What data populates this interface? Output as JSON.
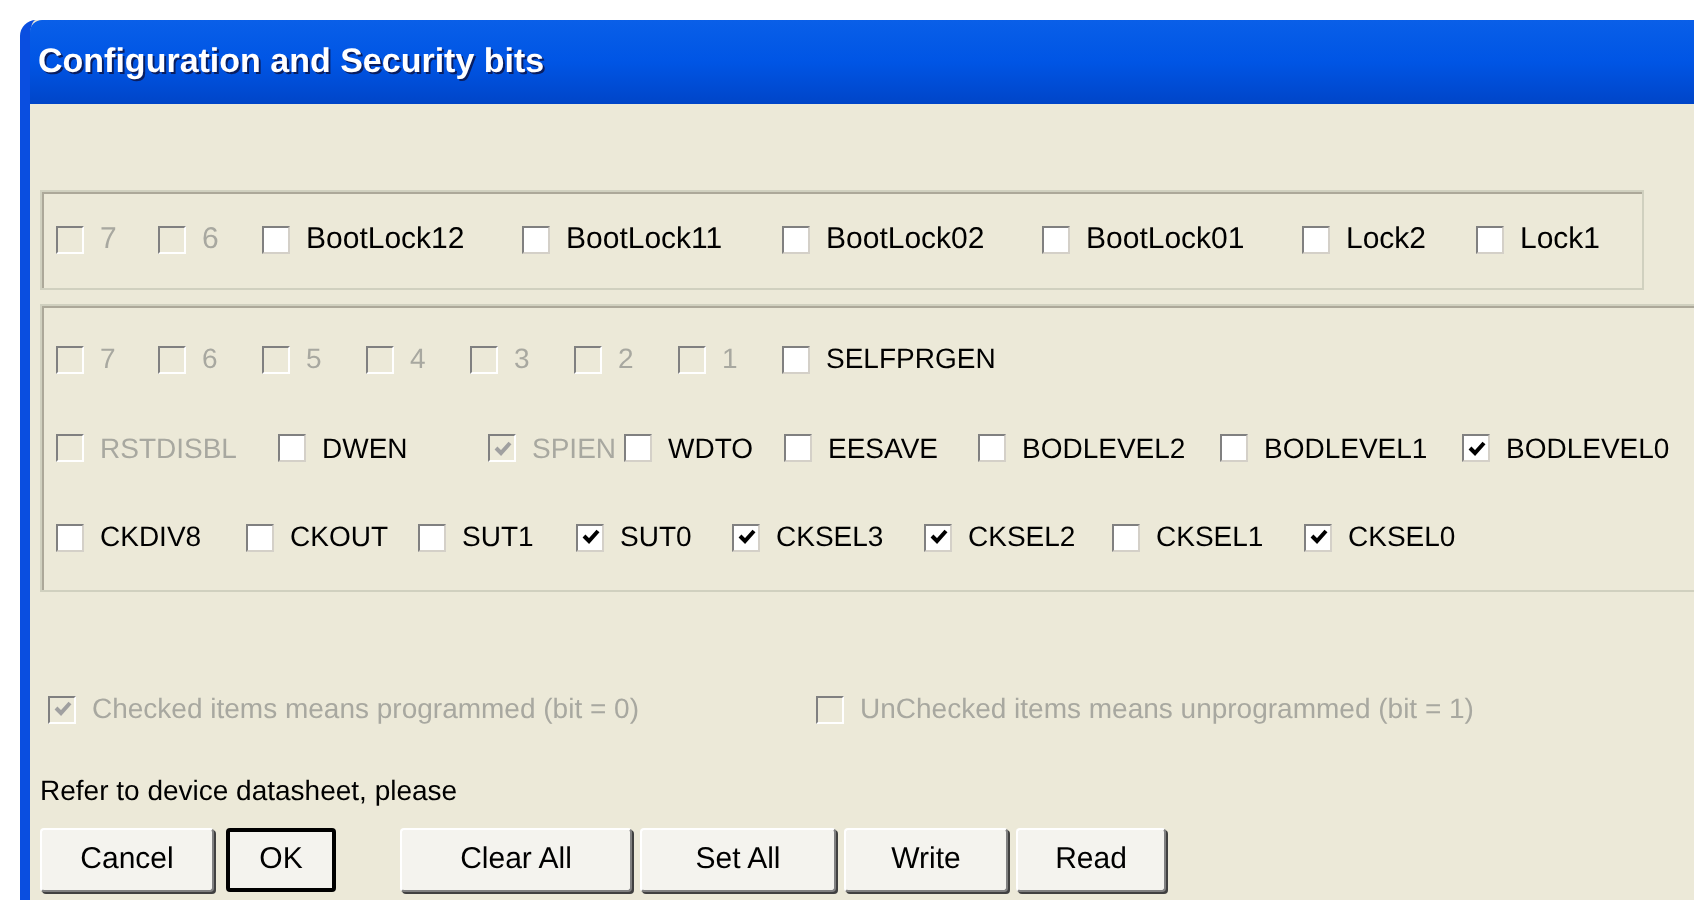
{
  "window": {
    "title": "Configuration and Security bits"
  },
  "lock_bits": [
    {
      "label": "7",
      "checked": false,
      "disabled": true
    },
    {
      "label": "6",
      "checked": false,
      "disabled": true
    },
    {
      "label": "BootLock12",
      "checked": false,
      "disabled": false
    },
    {
      "label": "BootLock11",
      "checked": false,
      "disabled": false
    },
    {
      "label": "BootLock02",
      "checked": false,
      "disabled": false
    },
    {
      "label": "BootLock01",
      "checked": false,
      "disabled": false
    },
    {
      "label": "Lock2",
      "checked": false,
      "disabled": false
    },
    {
      "label": "Lock1",
      "checked": false,
      "disabled": false
    }
  ],
  "fuse_rows": [
    [
      {
        "label": "7",
        "checked": false,
        "disabled": true
      },
      {
        "label": "6",
        "checked": false,
        "disabled": true
      },
      {
        "label": "5",
        "checked": false,
        "disabled": true
      },
      {
        "label": "4",
        "checked": false,
        "disabled": true
      },
      {
        "label": "3",
        "checked": false,
        "disabled": true
      },
      {
        "label": "2",
        "checked": false,
        "disabled": true
      },
      {
        "label": "1",
        "checked": false,
        "disabled": true
      },
      {
        "label": "SELFPRGEN",
        "checked": false,
        "disabled": false
      }
    ],
    [
      {
        "label": "RSTDISBL",
        "checked": false,
        "disabled": true
      },
      {
        "label": "DWEN",
        "checked": false,
        "disabled": false
      },
      {
        "label": "SPIEN",
        "checked": true,
        "disabled": true
      },
      {
        "label": "WDTO",
        "checked": false,
        "disabled": false
      },
      {
        "label": "EESAVE",
        "checked": false,
        "disabled": false
      },
      {
        "label": "BODLEVEL2",
        "checked": false,
        "disabled": false
      },
      {
        "label": "BODLEVEL1",
        "checked": false,
        "disabled": false
      },
      {
        "label": "BODLEVEL0",
        "checked": true,
        "disabled": false
      }
    ],
    [
      {
        "label": "CKDIV8",
        "checked": false,
        "disabled": false
      },
      {
        "label": "CKOUT",
        "checked": false,
        "disabled": false
      },
      {
        "label": "SUT1",
        "checked": false,
        "disabled": false
      },
      {
        "label": "SUT0",
        "checked": true,
        "disabled": false
      },
      {
        "label": "CKSEL3",
        "checked": true,
        "disabled": false
      },
      {
        "label": "CKSEL2",
        "checked": true,
        "disabled": false
      },
      {
        "label": "CKSEL1",
        "checked": false,
        "disabled": false
      },
      {
        "label": "CKSEL0",
        "checked": true,
        "disabled": false
      }
    ]
  ],
  "legend": [
    {
      "label": "Checked items means programmed (bit = 0)",
      "checked": true,
      "disabled": true
    },
    {
      "label": "UnChecked items means unprogrammed (bit = 1)",
      "checked": false,
      "disabled": true
    }
  ],
  "note": "Refer to device datasheet, please",
  "dialog_buttons": [
    {
      "label": "Cancel",
      "default": false
    },
    {
      "label": "OK",
      "default": true
    }
  ],
  "action_buttons": [
    {
      "label": "Clear All",
      "default": false
    },
    {
      "label": "Set All",
      "default": false
    },
    {
      "label": "Write",
      "default": false
    },
    {
      "label": "Read",
      "default": false
    }
  ]
}
